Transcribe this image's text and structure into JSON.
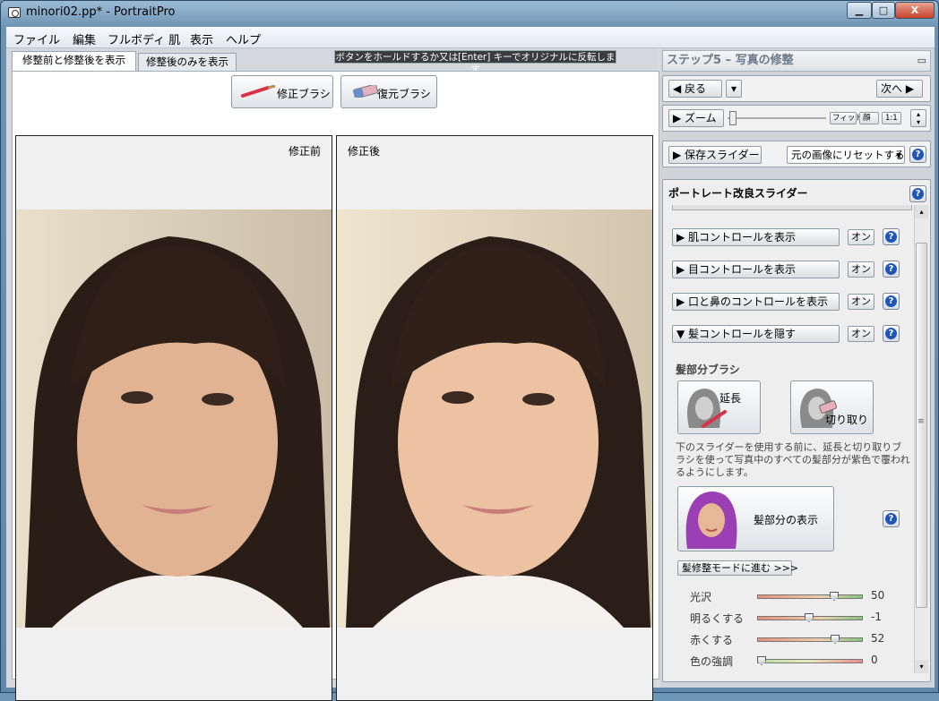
{
  "window": {
    "title": "minori02.pp* - PortraitPro",
    "min_label": "▁",
    "max_label": "□",
    "close_label": "X"
  },
  "menu": {
    "items": [
      "ファイル",
      "編集",
      "フルボディ 肌",
      "表示",
      "ヘルプ"
    ]
  },
  "view_tabs": {
    "before_after": "修整前と修整後を表示",
    "after_only": "修整後のみを表示"
  },
  "hint": "ボタンをホールドするか又は[Enter] キーでオリジナルに反転します",
  "tools": {
    "fix_brush": "修正ブラシ",
    "restore_brush": "復元ブラシ"
  },
  "panels": {
    "before": "修正前",
    "after": "修正後"
  },
  "step": {
    "title": "ステップ5 – 写真の修整",
    "dock_icon": "▭"
  },
  "nav": {
    "back": "◀ 戻る",
    "next": "次へ ▶"
  },
  "zoom": {
    "label": "▶ ズーム",
    "fit": "フィット",
    "face": "顔",
    "one_to_one": "1:1"
  },
  "save": {
    "sliders": "▶ 保存スライダー",
    "reset_select": "元の画像にリセットする"
  },
  "portrait": {
    "title": "ポートレート改良スライダー",
    "sections": [
      {
        "label": "▶ 肌コントロールを表示",
        "toggle": "オン"
      },
      {
        "label": "▶ 目コントロールを表示",
        "toggle": "オン"
      },
      {
        "label": "▶ 口と鼻のコントロールを表示",
        "toggle": "オン"
      },
      {
        "label": "▼ 髪コントロールを隠す",
        "toggle": "オン"
      }
    ],
    "hair_brush_title": "髪部分ブラシ",
    "extend_label": "延長",
    "cut_label": "切り取り",
    "description": "下のスライダーを使用する前に、延長と切り取りブラシを使って写真中のすべての髪部分が紫色で覆われるようにします。",
    "show_hair_label": "髪部分の表示",
    "advance_label": "髪修整モードに進む >>>",
    "scroll_grip": "≡",
    "sliders": [
      {
        "label": "光沢",
        "value": "50",
        "pos": 0.75
      },
      {
        "label": "明るくする",
        "value": "-1",
        "pos": 0.49
      },
      {
        "label": "赤くする",
        "value": "52",
        "pos": 0.76
      },
      {
        "label": "色の強調",
        "value": "0",
        "pos": 0.0
      }
    ]
  },
  "colors": {
    "accent": "#1f55b8",
    "titlebar": "#7ea3c2",
    "hair_purple": "#9b3fb5"
  }
}
